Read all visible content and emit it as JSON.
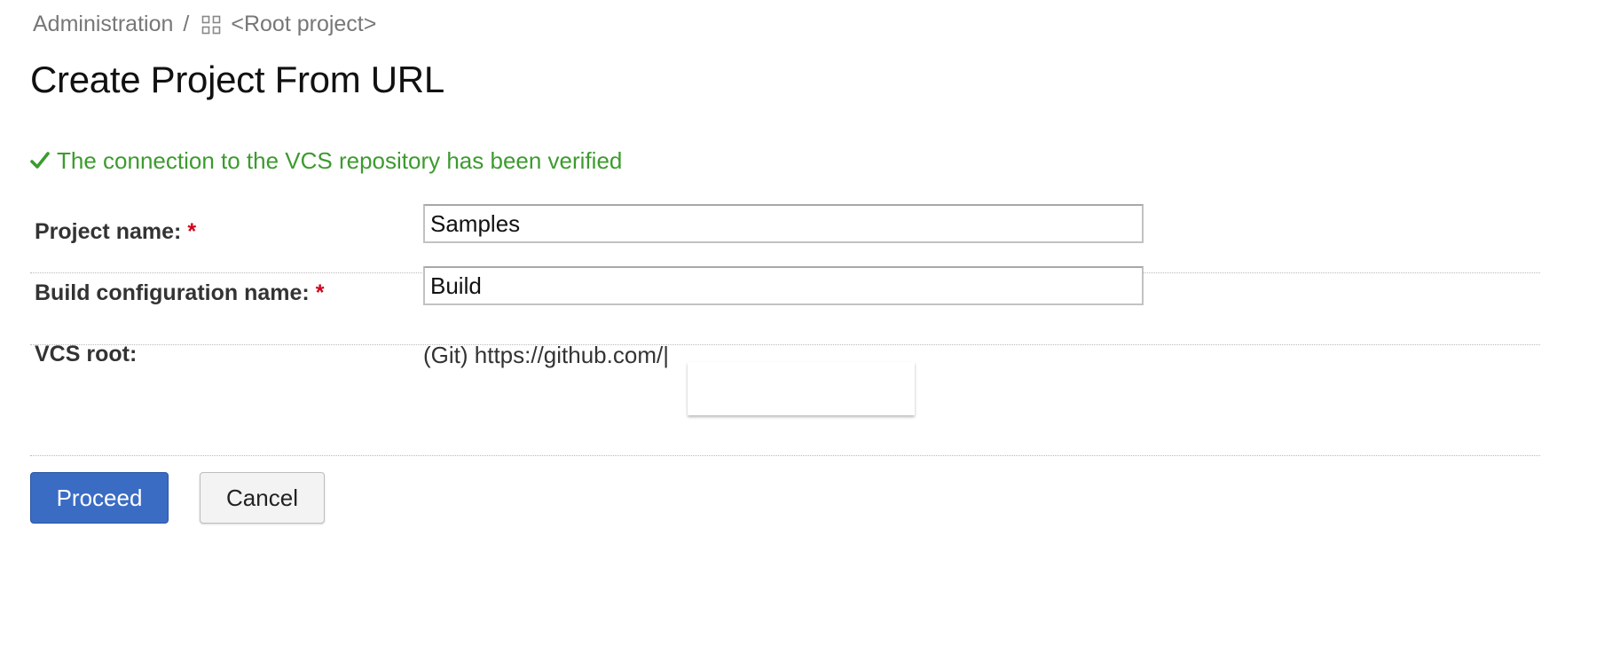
{
  "breadcrumb": {
    "admin_label": "Administration",
    "separator": "/",
    "project_icon": "project-grid-icon",
    "project_label": "<Root project>"
  },
  "page": {
    "title": "Create Project From URL"
  },
  "status": {
    "icon": "checkmark-icon",
    "message": "The connection to the VCS repository has been verified",
    "color": "#3c9b2e"
  },
  "form": {
    "project_name": {
      "label": "Project name:",
      "required_mark": "*",
      "value": "Samples"
    },
    "build_config_name": {
      "label": "Build configuration name:",
      "required_mark": "*",
      "value": "Build"
    },
    "vcs_root": {
      "label": "VCS root:",
      "value": "(Git) https://github.com/|"
    }
  },
  "buttons": {
    "proceed": "Proceed",
    "cancel": "Cancel"
  },
  "colors": {
    "primary_button": "#3a6cc4",
    "required": "#d0021b"
  }
}
